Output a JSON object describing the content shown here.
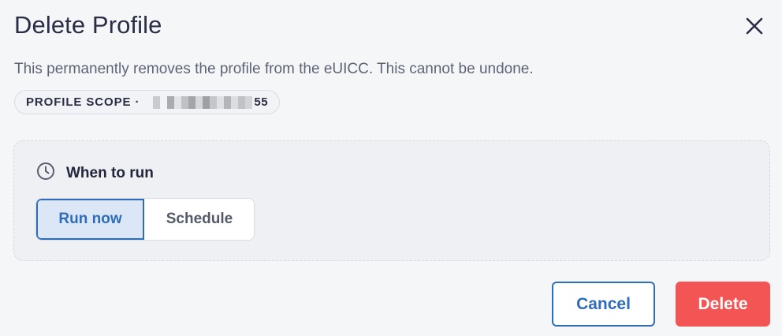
{
  "dialog": {
    "title": "Delete Profile",
    "close_icon": "close-icon",
    "description": "This permanently removes the profile from the eUICC. This cannot be undone.",
    "scope": {
      "label": "PROFILE SCOPE ·",
      "visible_suffix": "55"
    },
    "schedule": {
      "icon": "clock-icon",
      "heading": "When to run",
      "options": [
        {
          "label": "Run now",
          "selected": true
        },
        {
          "label": "Schedule",
          "selected": false
        }
      ]
    },
    "actions": {
      "cancel_label": "Cancel",
      "delete_label": "Delete"
    }
  },
  "colors": {
    "accent": "#2f6db8",
    "danger": "#f35454",
    "background": "#f5f6f8"
  }
}
